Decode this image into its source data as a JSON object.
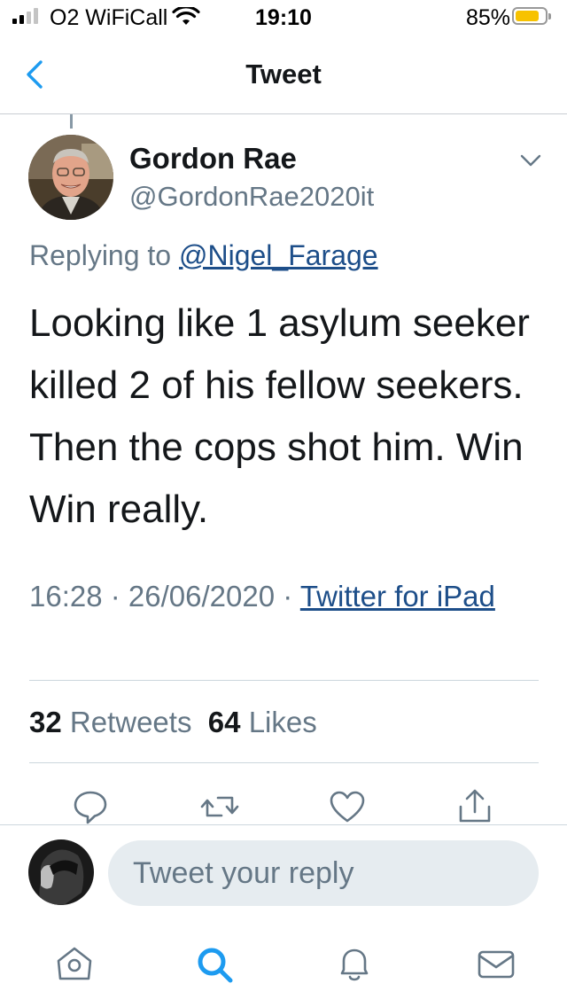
{
  "status_bar": {
    "carrier": "O2 WiFiCall",
    "time": "19:10",
    "battery": "85%",
    "battery_level": 0.85,
    "signal_bars": 2
  },
  "nav": {
    "back_icon": "chevron-left-icon",
    "title": "Tweet"
  },
  "tweet": {
    "author_name": "Gordon Rae",
    "author_handle": "@GordonRae2020it",
    "replying_prefix": "Replying to ",
    "replying_handle": "@Nigel_Farage",
    "text": "Looking like 1 asylum seeker killed 2 of his fellow seekers. Then the cops shot him. Win Win really.",
    "timestamp": "16:28 · 26/06/2020 · ",
    "source": "Twitter for iPad",
    "retweets_count": "32",
    "retweets_label": "Retweets",
    "likes_count": "64",
    "likes_label": "Likes"
  },
  "actions": [
    "reply-icon",
    "retweet-icon",
    "like-icon",
    "share-icon"
  ],
  "reply": {
    "placeholder": "Tweet your reply"
  },
  "tab_bar": [
    "home-icon",
    "search-icon",
    "notifications-icon",
    "messages-icon"
  ],
  "colors": {
    "accent": "#1da1f2",
    "link": "#1d4e89",
    "secondary_text": "#657786",
    "icon_blue": "#1d9bf0",
    "reply_box": "#e6ecf0"
  }
}
